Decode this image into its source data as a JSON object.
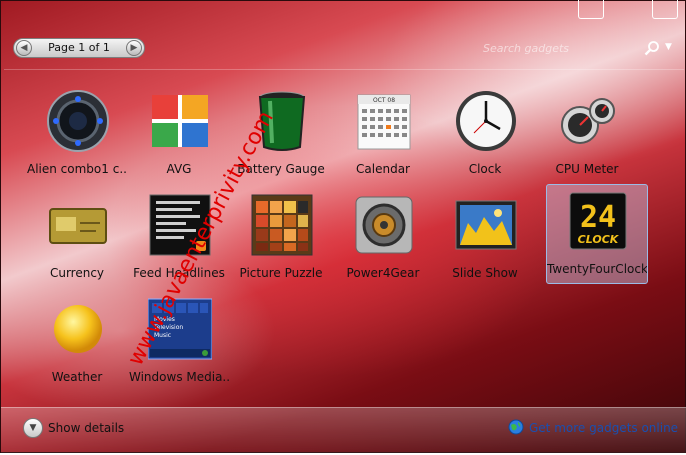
{
  "window": {
    "background_accent": "#c8343d"
  },
  "topbar": {
    "page_label": "Page 1 of 1",
    "search_placeholder": "Search gadgets",
    "prev_icon": "chevron-left-icon",
    "next_icon": "chevron-right-icon",
    "search_icon": "search-icon"
  },
  "gadgets": [
    {
      "label": "Alien combo1 c...",
      "icon": "alien-combo-icon",
      "selected": false
    },
    {
      "label": "AVG",
      "icon": "avg-icon",
      "selected": false
    },
    {
      "label": "Battery Gauge",
      "icon": "battery-gauge-icon",
      "selected": false
    },
    {
      "label": "Calendar",
      "icon": "calendar-icon",
      "selected": false
    },
    {
      "label": "Clock",
      "icon": "clock-icon",
      "selected": false
    },
    {
      "label": "CPU Meter",
      "icon": "cpu-meter-icon",
      "selected": false
    },
    {
      "label": "Currency",
      "icon": "currency-icon",
      "selected": false
    },
    {
      "label": "Feed Headlines",
      "icon": "feed-headlines-icon",
      "selected": false
    },
    {
      "label": "Picture Puzzle",
      "icon": "picture-puzzle-icon",
      "selected": false
    },
    {
      "label": "Power4Gear",
      "icon": "power4gear-icon",
      "selected": false
    },
    {
      "label": "Slide Show",
      "icon": "slide-show-icon",
      "selected": false
    },
    {
      "label": "TwentyFourClock",
      "icon": "twenty-four-clock-icon",
      "selected": true
    },
    {
      "label": "Weather",
      "icon": "weather-icon",
      "selected": false
    },
    {
      "label": "Windows Media...",
      "icon": "windows-media-icon",
      "selected": false
    }
  ],
  "icon_text": {
    "calendar_month": "OCT 08",
    "clock24_number": "24",
    "clock24_word": "CLOCK",
    "media_items": [
      "Movies",
      "Television",
      "Music"
    ]
  },
  "bottombar": {
    "show_details_label": "Show details",
    "more_gadgets_label": "Get more gadgets online"
  },
  "watermark": {
    "text": "www.javaenterprivity.com",
    "color": "#e00000"
  }
}
